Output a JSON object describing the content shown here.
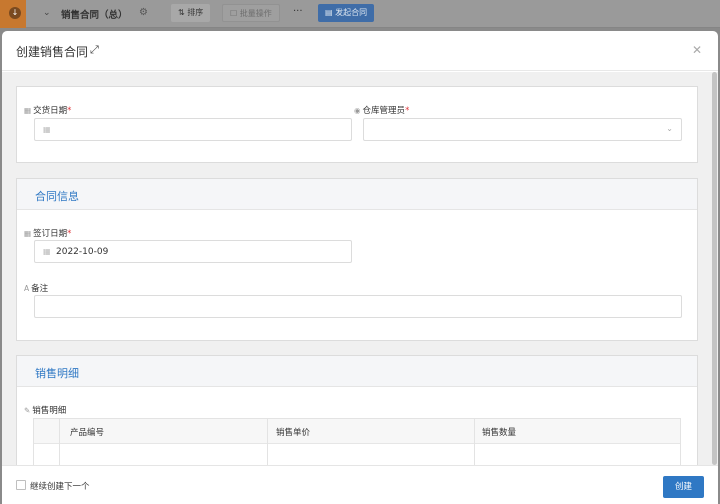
{
  "background": {
    "title": "销售合同（总）",
    "sort_label": "排序",
    "batch_label": "批量操作",
    "more_label": "···",
    "launch_label": "发起合同"
  },
  "modal": {
    "title": "创建销售合同",
    "section1": {
      "delivery_date_label": "交货日期",
      "delivery_date_value": "",
      "warehouse_manager_label": "仓库管理员",
      "warehouse_manager_value": ""
    },
    "contract_info": {
      "title": "合同信息",
      "sign_date_label": "签订日期",
      "sign_date_value": "2022-10-09",
      "remark_label": "备注",
      "remark_value": ""
    },
    "sales_detail": {
      "title": "销售明细",
      "table_label": "销售明细",
      "columns": [
        "产品编号",
        "销售单价",
        "销售数量"
      ]
    },
    "footer": {
      "continue_label": "继续创建下一个",
      "create_label": "创建"
    }
  },
  "colors": {
    "accent": "#2f78c4",
    "required": "#e0393e"
  },
  "icons": {
    "calendar": "calendar-icon",
    "person": "person-icon",
    "text": "text-icon",
    "edit": "edit-icon",
    "expand": "expand-icon",
    "close": "close-icon"
  }
}
